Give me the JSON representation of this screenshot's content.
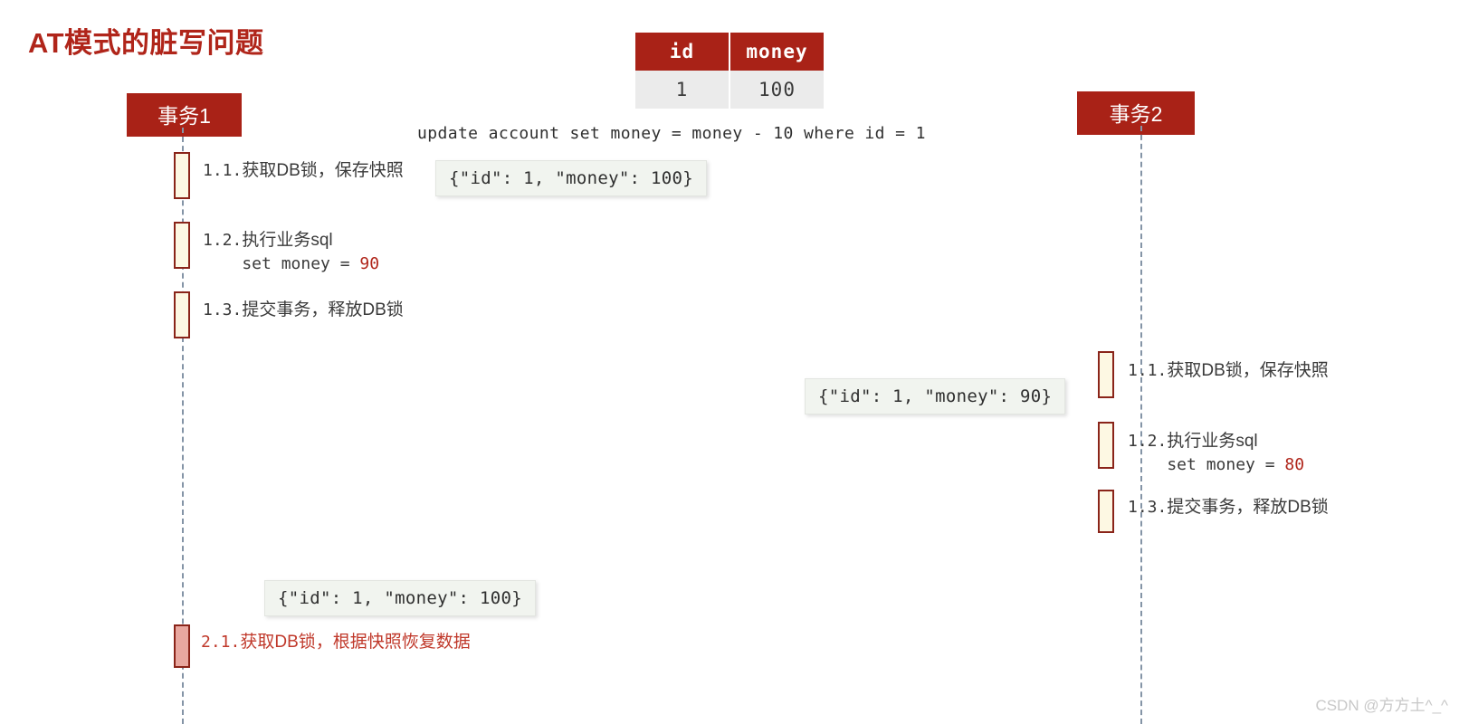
{
  "title": "AT模式的脏写问题",
  "colors": {
    "brand_red": "#A92217",
    "title_red": "#B0251A",
    "activation_fill": "#FDF8E3",
    "activation_border": "#8A2419",
    "rollback_fill": "#E8A79F",
    "lifeline": "#8494A6",
    "json_box_bg": "#F1F4EF",
    "table_row_bg": "#EBEBEB",
    "watermark": "#C8C8C8"
  },
  "db_table": {
    "headers": [
      "id",
      "money"
    ],
    "rows": [
      [
        "1",
        "100"
      ]
    ]
  },
  "sql": "update account set money = money - 10 where id = 1",
  "actors": [
    {
      "id": "tx1",
      "label": "事务1"
    },
    {
      "id": "tx2",
      "label": "事务2"
    }
  ],
  "tx1_steps": [
    {
      "index": "1.1.",
      "text": "获取DB锁，保存快照"
    },
    {
      "index": "1.2.",
      "text": "执行业务sql",
      "sub_prefix": "    set money = ",
      "sub_value": "90"
    },
    {
      "index": "1.3.",
      "text": "提交事务，释放DB锁"
    },
    {
      "index": "2.1.",
      "text": "获取DB锁，根据快照恢复数据",
      "rollback": true
    }
  ],
  "tx2_steps": [
    {
      "index": "1.1.",
      "text": "获取DB锁，保存快照"
    },
    {
      "index": "1.2.",
      "text": "执行业务sql",
      "sub_prefix": "    set money = ",
      "sub_value": "80"
    },
    {
      "index": "1.3.",
      "text": "提交事务，释放DB锁"
    }
  ],
  "snapshots": [
    {
      "id": "tx1-snapshot-before",
      "text": "{\"id\": 1, \"money\": 100}"
    },
    {
      "id": "tx2-snapshot-before",
      "text": "{\"id\": 1, \"money\": 90}"
    },
    {
      "id": "tx1-rollback-snapshot",
      "text": "{\"id\": 1, \"money\": 100}"
    }
  ],
  "watermark": "CSDN @方方土^_^"
}
